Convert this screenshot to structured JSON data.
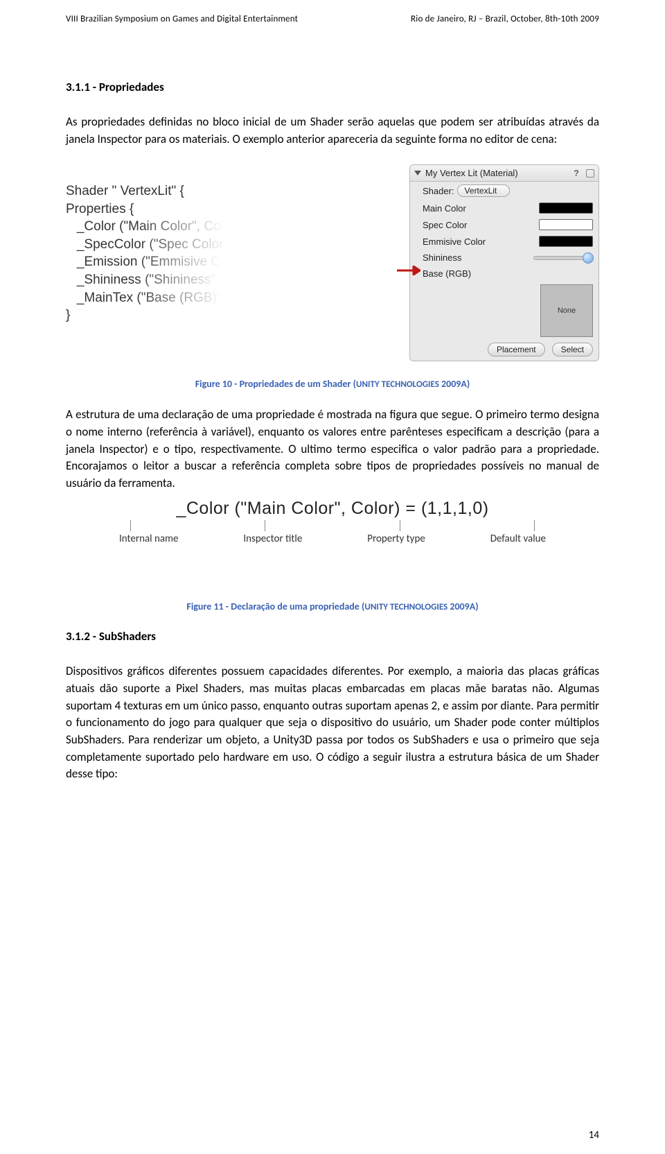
{
  "header": {
    "left": "VIII Brazilian Symposium on Games and Digital Entertainment",
    "right": "Rio de Janeiro, RJ – Brazil, October, 8th-10th 2009"
  },
  "sec1": {
    "heading": "3.1.1 - Propriedades",
    "para": "As propriedades definidas no bloco inicial de um Shader serão aquelas que podem ser atribuídas através da janela Inspector para os materiais. O exemplo anterior apareceria da seguinte forma no editor de cena:"
  },
  "fig1": {
    "code_lines": {
      "l0": "Shader \" VertexLit\" {",
      "l1": "Properties {",
      "l2": "   _Color (\"Main Color\", Col",
      "l3": "   _SpecColor (\"Spec Color\"",
      "l4": "   _Emission (\"Emmisive C",
      "l5": "   _Shininess (\"Shininess\",",
      "l6": "   _MainTex (\"Base (RGB)\"",
      "l7": "}"
    },
    "inspector": {
      "title": "My Vertex Lit (Material)",
      "shader_label": "Shader:",
      "shader_value": "VertexLit",
      "rows": {
        "main": "Main Color",
        "spec": "Spec Color",
        "emm": "Emmisive Color",
        "shin": "Shininess",
        "base": "Base (RGB)"
      },
      "none": "None",
      "placement": "Placement",
      "select": "Select"
    },
    "caption_a": "Figure 10 - Propriedades de um Shader (",
    "caption_b": "UNITY TECHNOLOGIES",
    "caption_c": " 2009A)"
  },
  "para2": "A estrutura de uma declaração de uma propriedade é mostrada na figura que segue. O primeiro termo designa o nome interno (referência à variável), enquanto os valores entre parênteses especificam a descrição (para a janela Inspector) e o tipo, respectivamente. O ultimo termo especifica o valor padrão para a propriedade. Encorajamos o leitor a buscar a referência completa sobre tipos de propriedades possíveis no manual de usuário da ferramenta.",
  "fig2": {
    "expr": "_Color (\"Main Color\", Color) = (1,1,1,0)",
    "labels": {
      "a": "Internal name",
      "b": "Inspector title",
      "c": "Property type",
      "d": "Default value"
    },
    "caption_a": "Figure 11 - Declaração de uma propriedade (",
    "caption_b": "UNITY TECHNOLOGIES",
    "caption_c": " 2009A)"
  },
  "sec2": {
    "heading": "3.1.2 - SubShaders",
    "para": "Dispositivos gráficos diferentes possuem capacidades diferentes. Por exemplo, a maioria das placas gráficas atuais dão suporte a Pixel Shaders, mas muitas placas embarcadas em placas mãe baratas não. Algumas suportam 4 texturas em um único passo, enquanto outras suportam apenas 2, e assim por diante. Para permitir o funcionamento do jogo para qualquer que seja o dispositivo do usuário,  um Shader pode conter múltiplos SubShaders. Para renderizar um objeto, a Unity3D passa por todos os SubShaders e usa o primeiro que seja completamente suportado pelo hardware em uso. O código a seguir ilustra a estrutura básica de um Shader desse tipo:"
  },
  "pagenum": "14"
}
